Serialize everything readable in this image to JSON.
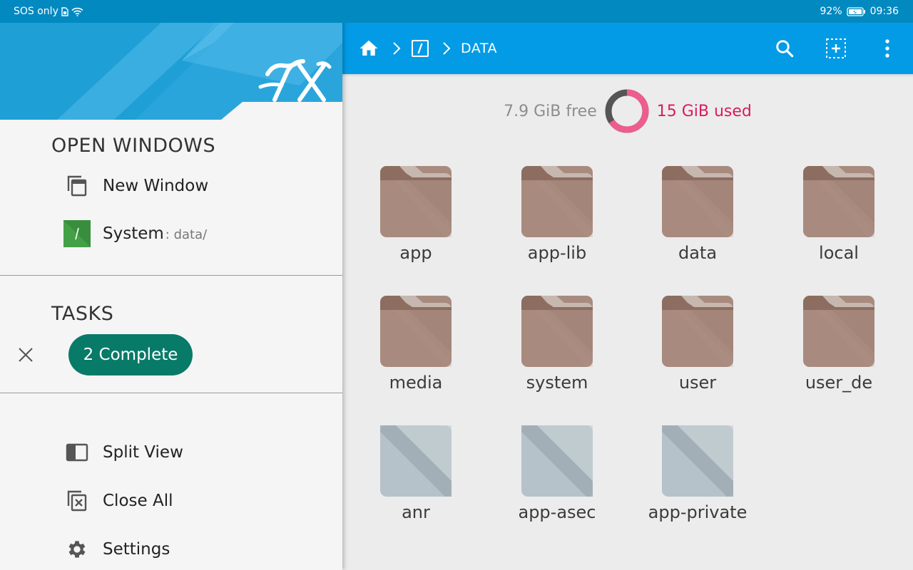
{
  "status_bar": {
    "carrier": "SOS only",
    "battery": "92%",
    "time": "09:36",
    "icons": [
      "sim-icon",
      "wifi-icon",
      "battery-icon"
    ]
  },
  "breadcrumb": {
    "items": [
      {
        "type": "icon",
        "icon": "home-icon"
      },
      {
        "type": "icon",
        "icon": "root-folder-icon"
      },
      {
        "type": "text",
        "label": "DATA"
      }
    ]
  },
  "toolbar": {
    "actions": [
      "search-icon",
      "select-icon",
      "overflow-menu-icon"
    ]
  },
  "storage": {
    "free_label": "7.9 GiB free",
    "used_label": "15 GiB used",
    "used_fraction": 0.655,
    "used_color": "#ec5e8d",
    "free_color": "#555555"
  },
  "files": [
    {
      "name": "app",
      "kind": "folder"
    },
    {
      "name": "app-lib",
      "kind": "folder"
    },
    {
      "name": "data",
      "kind": "folder"
    },
    {
      "name": "local",
      "kind": "folder"
    },
    {
      "name": "media",
      "kind": "folder"
    },
    {
      "name": "system",
      "kind": "folder"
    },
    {
      "name": "user",
      "kind": "folder"
    },
    {
      "name": "user_de",
      "kind": "folder"
    },
    {
      "name": "anr",
      "kind": "locked"
    },
    {
      "name": "app-asec",
      "kind": "locked"
    },
    {
      "name": "app-private",
      "kind": "locked"
    }
  ],
  "drawer": {
    "logo": "FX",
    "open_windows_title": "OPEN WINDOWS",
    "new_window_label": "New Window",
    "system_label": "System",
    "system_path": ": data/",
    "tasks_title": "TASKS",
    "tasks_button": "2 Complete",
    "split_view_label": "Split View",
    "close_all_label": "Close All",
    "settings_label": "Settings"
  },
  "colors": {
    "status_bar": "#0289c0",
    "app_bar": "#039be5",
    "folder": "#a88b7e",
    "folder_tab": "#8c6d60",
    "locked": "#b6c2c9",
    "task_pill": "#087a68"
  }
}
